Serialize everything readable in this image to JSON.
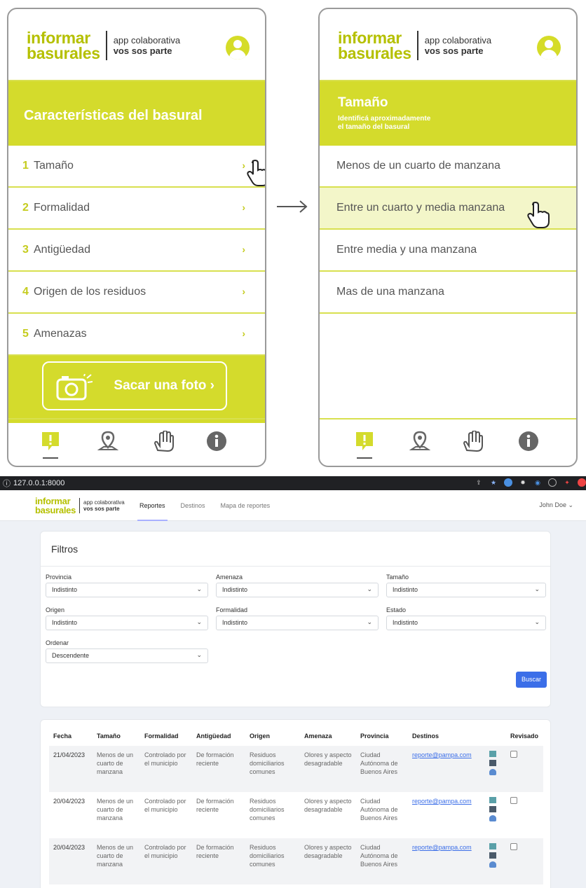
{
  "brand": {
    "main_line1": "informar",
    "main_line2": "basurales",
    "sub_line1": "app colaborativa",
    "sub_line2": "vos sos parte",
    "accent_color": "#d4db2c"
  },
  "phone_left": {
    "band_title": "Características del basural",
    "items": [
      {
        "num": "1",
        "label": "Tamaño",
        "chevron": "›"
      },
      {
        "num": "2",
        "label": "Formalidad",
        "chevron": "›"
      },
      {
        "num": "3",
        "label": "Antigüedad",
        "chevron": "›"
      },
      {
        "num": "4",
        "label": "Origen de los residuos",
        "chevron": "›"
      },
      {
        "num": "5",
        "label": "Amenazas",
        "chevron": "›"
      }
    ],
    "photo_button": "Sacar una foto ›"
  },
  "phone_right": {
    "band_title": "Tamaño",
    "band_sub_1": "Identificá aproximadamente",
    "band_sub_2": "el tamaño del basural",
    "options": [
      "Menos de un cuarto de manzana",
      "Entre un cuarto y media manzana",
      "Entre media y una manzana",
      "Mas de una manzana"
    ],
    "selected_index": 1
  },
  "nav_icons": [
    "report-icon",
    "map-pin-icon",
    "hand-icon",
    "info-icon"
  ],
  "browser": {
    "url": "127.0.0.1:8000",
    "nav": [
      "Reportes",
      "Destinos",
      "Mapa de reportes"
    ],
    "user": "John Doe ⌄",
    "filters_title": "Filtros",
    "filters": [
      {
        "label": "Provincia",
        "value": "Indistinto"
      },
      {
        "label": "Amenaza",
        "value": "Indistinto"
      },
      {
        "label": "Tamaño",
        "value": "Indistinto"
      },
      {
        "label": "Origen",
        "value": "Indistinto"
      },
      {
        "label": "Formalidad",
        "value": "Indistinto"
      },
      {
        "label": "Estado",
        "value": "Indistinto"
      },
      {
        "label": "Ordenar",
        "value": "Descendente"
      }
    ],
    "search_button": "Buscar",
    "columns": [
      "Fecha",
      "Tamaño",
      "Formalidad",
      "Antigüedad",
      "Origen",
      "Amenaza",
      "Provincia",
      "Destinos",
      "",
      "Revisado"
    ],
    "rows": [
      {
        "fecha": "21/04/2023",
        "tamano": "Menos de un cuarto de manzana",
        "formalidad": "Controlado por el municipio",
        "antiguedad": "De formación reciente",
        "origen": "Residuos domiciliarios comunes",
        "amenaza": "Olores y aspecto desagradable",
        "provincia": "Ciudad Autónoma de Buenos Aires",
        "destino": "reporte@pampa.com"
      },
      {
        "fecha": "20/04/2023",
        "tamano": "Menos de un cuarto de manzana",
        "formalidad": "Controlado por el municipio",
        "antiguedad": "De formación reciente",
        "origen": "Residuos domiciliarios comunes",
        "amenaza": "Olores y aspecto desagradable",
        "provincia": "Ciudad Autónoma de Buenos Aires",
        "destino": "reporte@pampa.com"
      },
      {
        "fecha": "20/04/2023",
        "tamano": "Menos de un cuarto de manzana",
        "formalidad": "Controlado por el municipio",
        "antiguedad": "De formación reciente",
        "origen": "Residuos domiciliarios comunes",
        "amenaza": "Olores y aspecto desagradable",
        "provincia": "Ciudad Autónoma de Buenos Aires",
        "destino": "reporte@pampa.com"
      }
    ]
  }
}
